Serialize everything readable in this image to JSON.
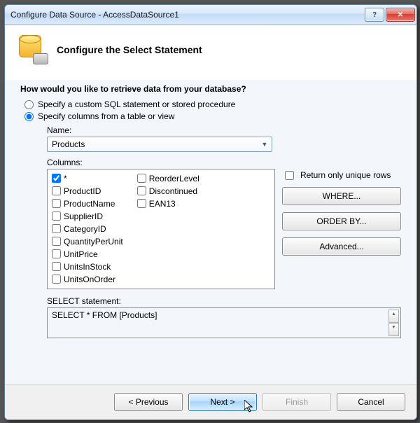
{
  "titlebar": {
    "title": "Configure Data Source - AccessDataSource1"
  },
  "header": {
    "heading": "Configure the Select Statement"
  },
  "prompt": "How would you like to retrieve data from your database?",
  "radios": {
    "custom": {
      "label": "Specify a custom SQL statement or stored procedure",
      "checked": false
    },
    "columns": {
      "label": "Specify columns from a table or view",
      "checked": true
    }
  },
  "table": {
    "name_label": "Name:",
    "selected": "Products"
  },
  "columns": {
    "label": "Columns:",
    "left": [
      {
        "label": "*",
        "checked": true
      },
      {
        "label": "ProductID",
        "checked": false
      },
      {
        "label": "ProductName",
        "checked": false
      },
      {
        "label": "SupplierID",
        "checked": false
      },
      {
        "label": "CategoryID",
        "checked": false
      },
      {
        "label": "QuantityPerUnit",
        "checked": false
      },
      {
        "label": "UnitPrice",
        "checked": false
      },
      {
        "label": "UnitsInStock",
        "checked": false
      },
      {
        "label": "UnitsOnOrder",
        "checked": false
      }
    ],
    "right": [
      {
        "label": "ReorderLevel",
        "checked": false
      },
      {
        "label": "Discontinued",
        "checked": false
      },
      {
        "label": "EAN13",
        "checked": false
      }
    ]
  },
  "options": {
    "unique_label": "Return only unique rows",
    "where": "WHERE...",
    "orderby": "ORDER BY...",
    "advanced": "Advanced..."
  },
  "statement": {
    "label": "SELECT statement:",
    "text": "SELECT * FROM [Products]"
  },
  "footer": {
    "previous": "< Previous",
    "next": "Next >",
    "finish": "Finish",
    "cancel": "Cancel"
  }
}
